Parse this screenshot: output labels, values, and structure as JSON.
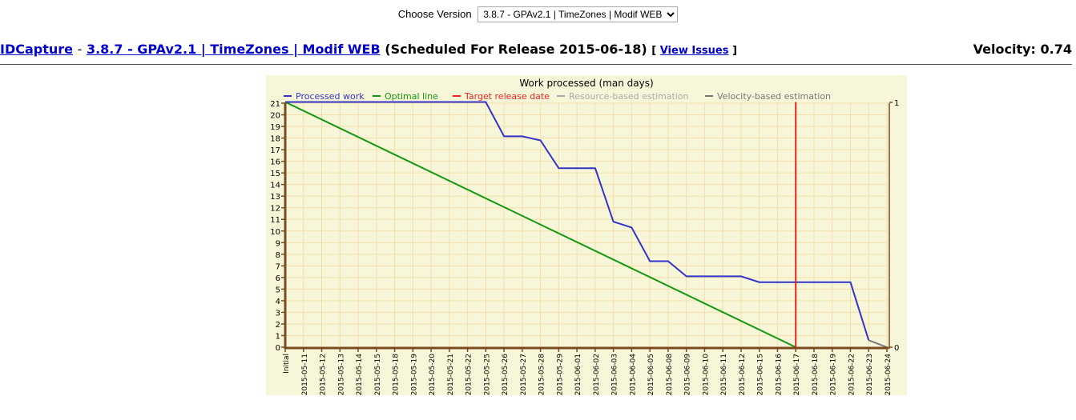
{
  "version_selector": {
    "label": "Choose Version",
    "selected": "3.8.7 - GPAv2.1 | TimeZones | Modif WEB"
  },
  "header": {
    "project_link": "IDCapture",
    "separator": "-",
    "version_link": "3.8.7 - GPAv2.1 | TimeZones | Modif WEB",
    "scheduled_text": "(Scheduled For Release 2015-06-18)",
    "issues_open": "[",
    "issues_link": "View Issues",
    "issues_close": "]",
    "velocity": "Velocity: 0.74"
  },
  "colors": {
    "processed": "#3333cc",
    "optimal": "#119911",
    "target": "#ee2222",
    "resource": "#aaaaaa",
    "velocity": "#777777",
    "axis": "#7b4a1e",
    "grid": "#f3dfa8",
    "background": "#f8f6d8"
  },
  "chart_data": {
    "type": "line",
    "title": "Work processed (man days)",
    "xlabel": "",
    "ylabel": "",
    "ylim": [
      0,
      21
    ],
    "y2lim": [
      0,
      1
    ],
    "y2_ticks": [
      "0",
      "1"
    ],
    "grid": true,
    "legend_position": "top",
    "categories": [
      "Initial",
      "2015-05-11",
      "2015-05-12",
      "2015-05-13",
      "2015-05-14",
      "2015-05-15",
      "2015-05-18",
      "2015-05-19",
      "2015-05-20",
      "2015-05-21",
      "2015-05-22",
      "2015-05-25",
      "2015-05-26",
      "2015-05-27",
      "2015-05-28",
      "2015-05-29",
      "2015-06-01",
      "2015-06-02",
      "2015-06-03",
      "2015-06-04",
      "2015-06-05",
      "2015-06-08",
      "2015-06-09",
      "2015-06-10",
      "2015-06-11",
      "2015-06-12",
      "2015-06-15",
      "2015-06-16",
      "2015-06-17",
      "2015-06-18",
      "2015-06-19",
      "2015-06-22",
      "2015-06-23",
      "2015-06-24"
    ],
    "y_ticks": [
      0,
      1,
      2,
      3,
      4,
      5,
      6,
      7,
      8,
      9,
      10,
      11,
      12,
      13,
      14,
      15,
      16,
      17,
      18,
      19,
      20,
      21
    ],
    "series": [
      {
        "name": "Processed work",
        "color_key": "processed",
        "points": [
          [
            "Initial",
            21.1
          ],
          [
            "2015-05-11",
            21.1
          ],
          [
            "2015-05-12",
            21.1
          ],
          [
            "2015-05-13",
            21.1
          ],
          [
            "2015-05-14",
            21.1
          ],
          [
            "2015-05-15",
            21.1
          ],
          [
            "2015-05-18",
            21.1
          ],
          [
            "2015-05-19",
            21.1
          ],
          [
            "2015-05-20",
            21.1
          ],
          [
            "2015-05-21",
            21.1
          ],
          [
            "2015-05-22",
            21.1
          ],
          [
            "2015-05-25",
            21.1
          ],
          [
            "2015-05-26",
            18.15
          ],
          [
            "2015-05-27",
            18.15
          ],
          [
            "2015-05-28",
            17.8
          ],
          [
            "2015-05-29",
            15.4
          ],
          [
            "2015-06-01",
            15.4
          ],
          [
            "2015-06-02",
            15.4
          ],
          [
            "2015-06-03",
            10.8
          ],
          [
            "2015-06-04",
            10.3
          ],
          [
            "2015-06-05",
            7.4
          ],
          [
            "2015-06-08",
            7.4
          ],
          [
            "2015-06-09",
            6.1
          ],
          [
            "2015-06-10",
            6.1
          ],
          [
            "2015-06-11",
            6.1
          ],
          [
            "2015-06-12",
            6.1
          ],
          [
            "2015-06-15",
            5.6
          ],
          [
            "2015-06-16",
            5.6
          ],
          [
            "2015-06-17",
            5.6
          ],
          [
            "2015-06-18",
            5.6
          ],
          [
            "2015-06-19",
            5.6
          ],
          [
            "2015-06-22",
            5.6
          ],
          [
            "2015-06-23",
            0.6
          ]
        ]
      },
      {
        "name": "Optimal line",
        "color_key": "optimal",
        "points": [
          [
            "Initial",
            21.1
          ],
          [
            "2015-06-17",
            0
          ]
        ]
      },
      {
        "name": "Target release date",
        "color_key": "target",
        "points": [
          [
            "2015-06-17",
            0
          ],
          [
            "2015-06-17",
            21.1
          ]
        ]
      },
      {
        "name": "Resource-based estimation",
        "color_key": "resource",
        "points": []
      },
      {
        "name": "Velocity-based estimation",
        "color_key": "velocity",
        "points": [
          [
            "2015-06-23",
            0.6
          ],
          [
            "2015-06-24",
            0
          ]
        ]
      }
    ]
  }
}
